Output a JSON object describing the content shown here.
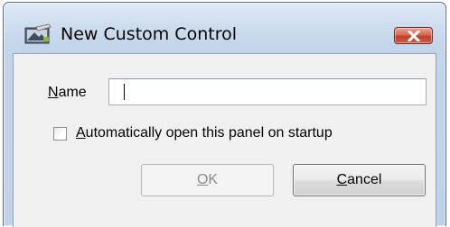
{
  "window": {
    "title": "New Custom Control"
  },
  "form": {
    "name_label_hotkey": "N",
    "name_label_rest": "ame",
    "name_value": "",
    "checkbox_hotkey": "A",
    "checkbox_rest": "utomatically open this panel on startup",
    "checkbox_checked": false
  },
  "buttons": {
    "ok_hotkey": "O",
    "ok_rest": "K",
    "ok_enabled": false,
    "cancel_hotkey": "C",
    "cancel_rest": "ancel"
  },
  "icons": {
    "app": "control-panel-icon",
    "close": "close-icon",
    "checkbox": "checkbox-unchecked-icon"
  },
  "colors": {
    "close_button": "#c94b33",
    "disabled_text": "#8c8c8c"
  }
}
